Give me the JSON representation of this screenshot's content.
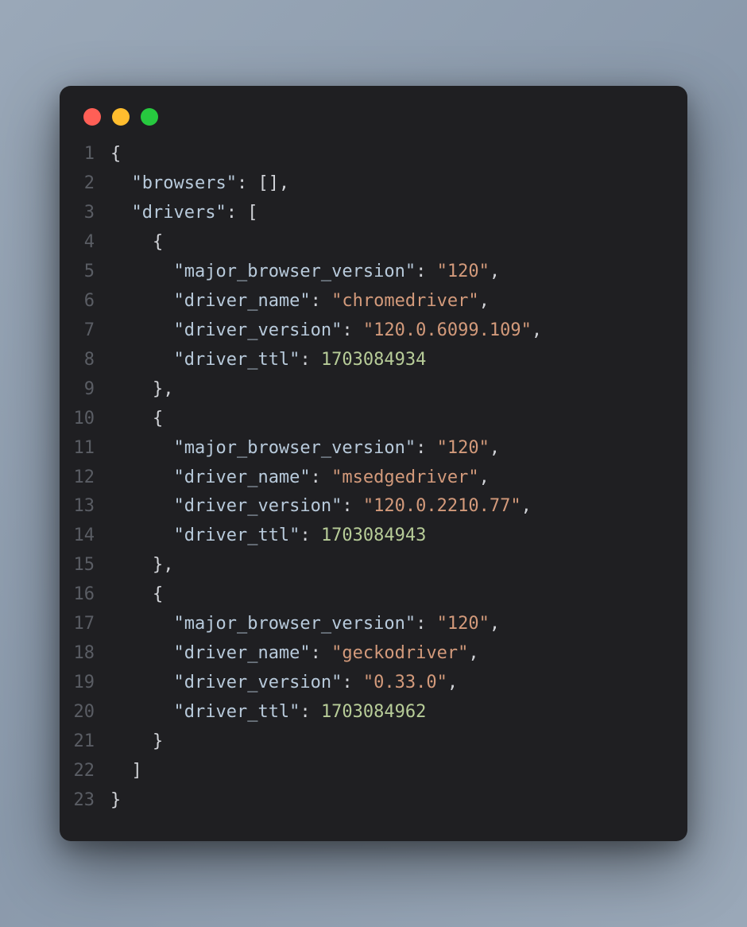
{
  "window": {
    "traffic_lights": [
      "close",
      "minimize",
      "zoom"
    ]
  },
  "code_content": {
    "browsers": [],
    "drivers": [
      {
        "major_browser_version": "120",
        "driver_name": "chromedriver",
        "driver_version": "120.0.6099.109",
        "driver_ttl": 1703084934
      },
      {
        "major_browser_version": "120",
        "driver_name": "msedgedriver",
        "driver_version": "120.0.2210.77",
        "driver_ttl": 1703084943
      },
      {
        "major_browser_version": "120",
        "driver_name": "geckodriver",
        "driver_version": "0.33.0",
        "driver_ttl": 1703084962
      }
    ]
  },
  "lines": [
    {
      "num": "1",
      "tokens": [
        [
          "punct",
          "{"
        ]
      ]
    },
    {
      "num": "2",
      "tokens": [
        [
          "punct",
          "  "
        ],
        [
          "key",
          "\"browsers\""
        ],
        [
          "punct",
          ": [],"
        ]
      ]
    },
    {
      "num": "3",
      "tokens": [
        [
          "punct",
          "  "
        ],
        [
          "key",
          "\"drivers\""
        ],
        [
          "punct",
          ": ["
        ]
      ]
    },
    {
      "num": "4",
      "tokens": [
        [
          "punct",
          "    {"
        ]
      ]
    },
    {
      "num": "5",
      "tokens": [
        [
          "punct",
          "      "
        ],
        [
          "key",
          "\"major_browser_version\""
        ],
        [
          "punct",
          ": "
        ],
        [
          "string",
          "\"120\""
        ],
        [
          "punct",
          ","
        ]
      ]
    },
    {
      "num": "6",
      "tokens": [
        [
          "punct",
          "      "
        ],
        [
          "key",
          "\"driver_name\""
        ],
        [
          "punct",
          ": "
        ],
        [
          "string",
          "\"chromedriver\""
        ],
        [
          "punct",
          ","
        ]
      ]
    },
    {
      "num": "7",
      "tokens": [
        [
          "punct",
          "      "
        ],
        [
          "key",
          "\"driver_version\""
        ],
        [
          "punct",
          ": "
        ],
        [
          "string",
          "\"120.0.6099.109\""
        ],
        [
          "punct",
          ","
        ]
      ]
    },
    {
      "num": "8",
      "tokens": [
        [
          "punct",
          "      "
        ],
        [
          "key",
          "\"driver_ttl\""
        ],
        [
          "punct",
          ": "
        ],
        [
          "number",
          "1703084934"
        ]
      ]
    },
    {
      "num": "9",
      "tokens": [
        [
          "punct",
          "    },"
        ]
      ]
    },
    {
      "num": "10",
      "tokens": [
        [
          "punct",
          "    {"
        ]
      ]
    },
    {
      "num": "11",
      "tokens": [
        [
          "punct",
          "      "
        ],
        [
          "key",
          "\"major_browser_version\""
        ],
        [
          "punct",
          ": "
        ],
        [
          "string",
          "\"120\""
        ],
        [
          "punct",
          ","
        ]
      ]
    },
    {
      "num": "12",
      "tokens": [
        [
          "punct",
          "      "
        ],
        [
          "key",
          "\"driver_name\""
        ],
        [
          "punct",
          ": "
        ],
        [
          "string",
          "\"msedgedriver\""
        ],
        [
          "punct",
          ","
        ]
      ]
    },
    {
      "num": "13",
      "tokens": [
        [
          "punct",
          "      "
        ],
        [
          "key",
          "\"driver_version\""
        ],
        [
          "punct",
          ": "
        ],
        [
          "string",
          "\"120.0.2210.77\""
        ],
        [
          "punct",
          ","
        ]
      ]
    },
    {
      "num": "14",
      "tokens": [
        [
          "punct",
          "      "
        ],
        [
          "key",
          "\"driver_ttl\""
        ],
        [
          "punct",
          ": "
        ],
        [
          "number",
          "1703084943"
        ]
      ]
    },
    {
      "num": "15",
      "tokens": [
        [
          "punct",
          "    },"
        ]
      ]
    },
    {
      "num": "16",
      "tokens": [
        [
          "punct",
          "    {"
        ]
      ]
    },
    {
      "num": "17",
      "tokens": [
        [
          "punct",
          "      "
        ],
        [
          "key",
          "\"major_browser_version\""
        ],
        [
          "punct",
          ": "
        ],
        [
          "string",
          "\"120\""
        ],
        [
          "punct",
          ","
        ]
      ]
    },
    {
      "num": "18",
      "tokens": [
        [
          "punct",
          "      "
        ],
        [
          "key",
          "\"driver_name\""
        ],
        [
          "punct",
          ": "
        ],
        [
          "string",
          "\"geckodriver\""
        ],
        [
          "punct",
          ","
        ]
      ]
    },
    {
      "num": "19",
      "tokens": [
        [
          "punct",
          "      "
        ],
        [
          "key",
          "\"driver_version\""
        ],
        [
          "punct",
          ": "
        ],
        [
          "string",
          "\"0.33.0\""
        ],
        [
          "punct",
          ","
        ]
      ]
    },
    {
      "num": "20",
      "tokens": [
        [
          "punct",
          "      "
        ],
        [
          "key",
          "\"driver_ttl\""
        ],
        [
          "punct",
          ": "
        ],
        [
          "number",
          "1703084962"
        ]
      ]
    },
    {
      "num": "21",
      "tokens": [
        [
          "punct",
          "    }"
        ]
      ]
    },
    {
      "num": "22",
      "tokens": [
        [
          "punct",
          "  ]"
        ]
      ]
    },
    {
      "num": "23",
      "tokens": [
        [
          "punct",
          "}"
        ]
      ]
    }
  ]
}
